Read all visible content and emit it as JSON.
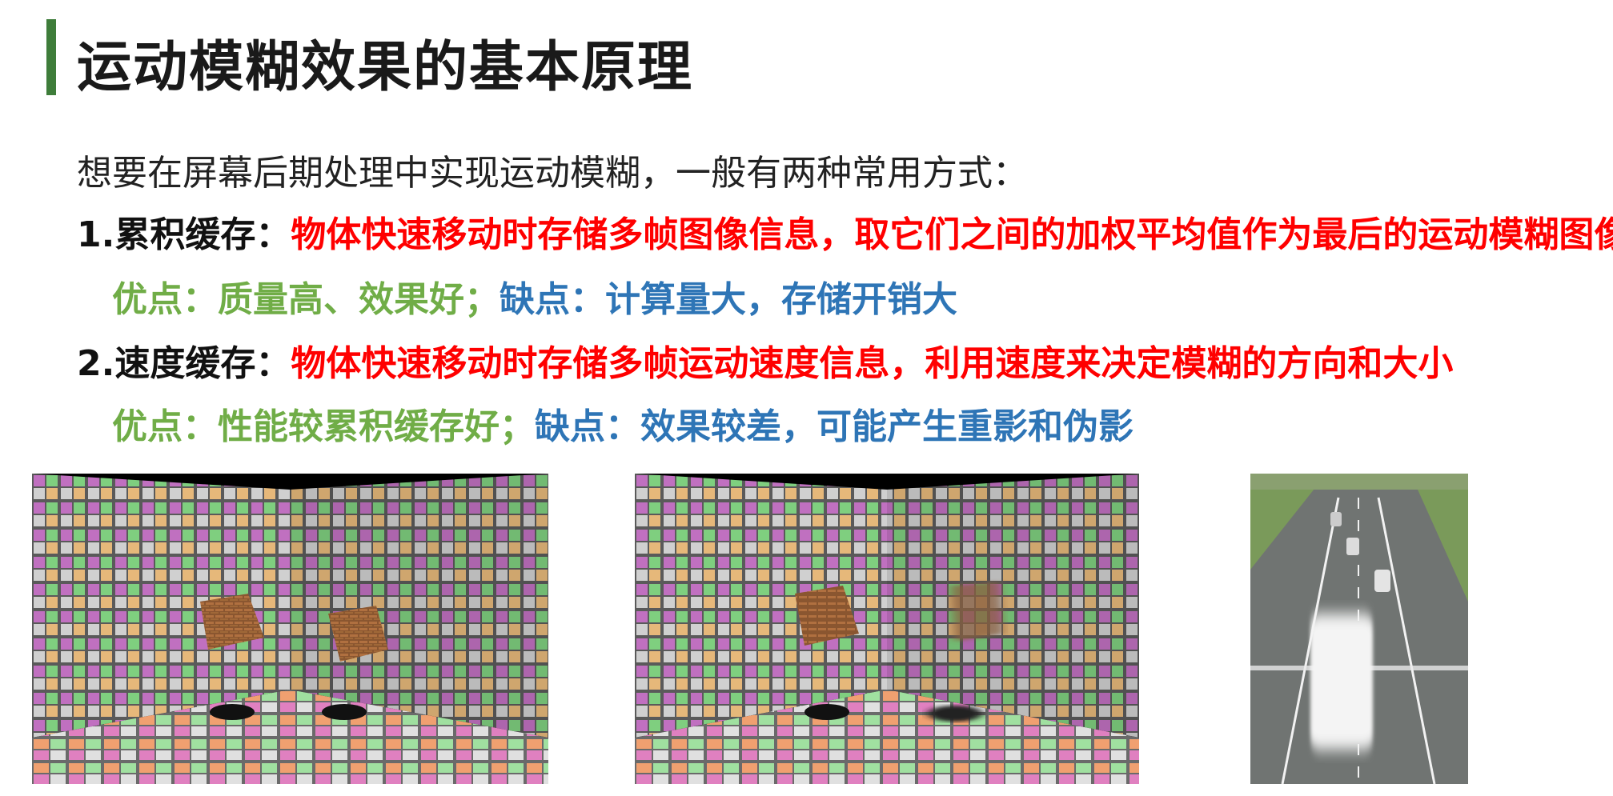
{
  "slide": {
    "title": "运动模糊效果的基本原理",
    "intro": "想要在屏幕后期处理中实现运动模糊，一般有两种常用方式：",
    "method1": {
      "label": "1.累积缓存：",
      "description": "物体快速移动时存储多帧图像信息，取它们之间的加权平均值作为最后的运动模糊图像",
      "pros_label": "优点：",
      "pros": "质量高、效果好；",
      "cons_label": "缺点：",
      "cons": "计算量大，存储开销大"
    },
    "method2": {
      "label": "2.速度缓存：",
      "description": "物体快速移动时存储多帧运动速度信息，利用速度来决定模糊的方向和大小",
      "pros_label": "优点：",
      "pros": "性能较累积缓存好；",
      "cons_label": "缺点：",
      "cons": "效果较差，可能产生重影和伪影"
    }
  },
  "colors": {
    "accent_bar": "#3e7d3a",
    "highlight_red": "#ff0000",
    "pros_green": "#70ad47",
    "cons_blue": "#2e75b6"
  }
}
